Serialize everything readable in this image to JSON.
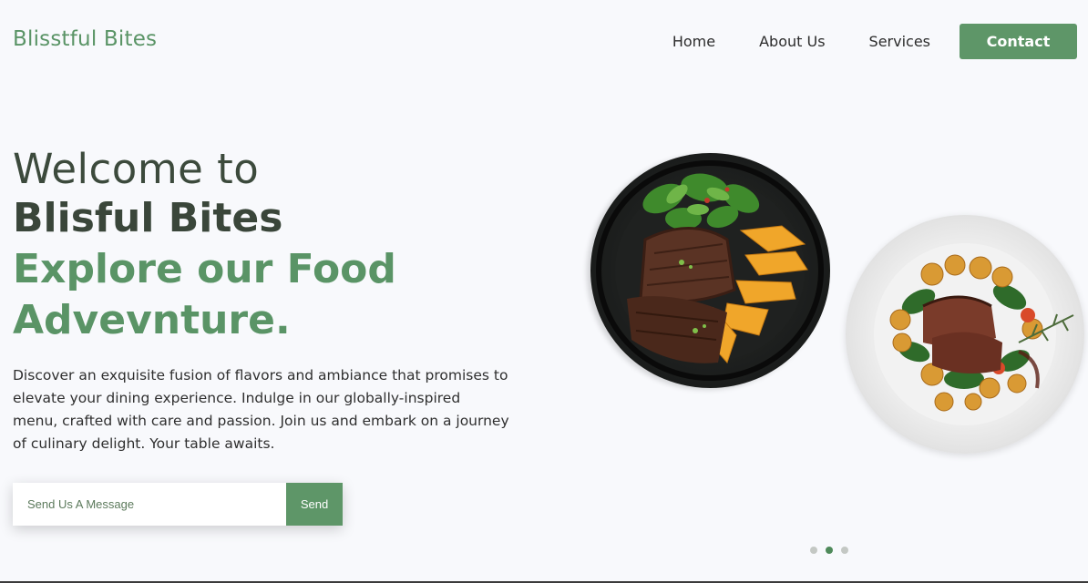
{
  "brand": "Blisstful Bites",
  "nav": {
    "links": [
      "Home",
      "About Us",
      "Services"
    ],
    "contact": "Contact"
  },
  "hero": {
    "line1": "Welcome to",
    "line2": "Blisful Bites",
    "line3a": "Explore our Food",
    "line3b": "Advevnture.",
    "description": "Discover an exquisite fusion of flavors and ambiance that promises to elevate your dining experience. Indulge in our globally-inspired menu, crafted with care and passion. Join us and embark on a journey of culinary delight. Your table awaits."
  },
  "message_form": {
    "placeholder": "Send Us A Message",
    "send_label": "Send"
  },
  "carousel": {
    "slides": 3,
    "active_index": 1
  },
  "colors": {
    "accent": "#5e9668",
    "brand_text": "#5a9466",
    "heading": "#3a463a"
  }
}
